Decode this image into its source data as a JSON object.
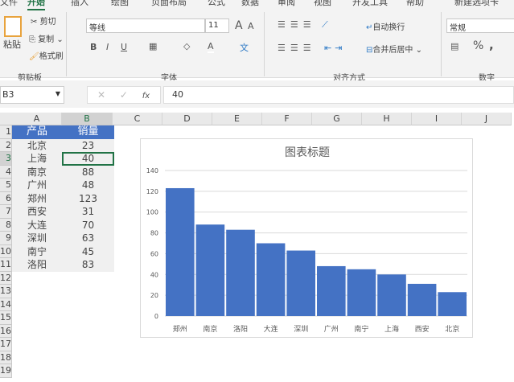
{
  "tabs": [
    "文件",
    "开始",
    "插入",
    "绘图",
    "页面布局",
    "公式",
    "数据",
    "审阅",
    "视图",
    "开发工具",
    "帮助",
    "新建选项卡"
  ],
  "clipboard": {
    "paste": "粘贴",
    "cut": "剪切",
    "copy": "复制",
    "format_painter": "格式刷",
    "group": "剪贴板"
  },
  "font": {
    "name": "等线",
    "size": "11",
    "bold": "B",
    "italic": "I",
    "underline": "U",
    "grow": "A",
    "shrink": "A",
    "color": "A",
    "group": "字体"
  },
  "alignment": {
    "wrap": "自动换行",
    "merge": "合并后居中",
    "group": "对齐方式"
  },
  "number": {
    "format": "常规",
    "percent": "%",
    "comma": ",",
    "group": "数字"
  },
  "formula_bar": {
    "name_box": "B3",
    "fx": "fx",
    "value": "40"
  },
  "columns": [
    "A",
    "B",
    "C",
    "D",
    "E",
    "F",
    "G",
    "H",
    "I",
    "J"
  ],
  "rows": [
    "1",
    "2",
    "3",
    "4",
    "5",
    "6",
    "7",
    "8",
    "9",
    "10",
    "11",
    "12",
    "13",
    "14",
    "15",
    "16",
    "17",
    "18",
    "19"
  ],
  "table": {
    "headers": [
      "产品",
      "销量"
    ],
    "rows": [
      [
        "北京",
        "23"
      ],
      [
        "上海",
        "40"
      ],
      [
        "南京",
        "88"
      ],
      [
        "广州",
        "48"
      ],
      [
        "郑州",
        "123"
      ],
      [
        "西安",
        "31"
      ],
      [
        "大连",
        "70"
      ],
      [
        "深圳",
        "63"
      ],
      [
        "南宁",
        "45"
      ],
      [
        "洛阳",
        "83"
      ]
    ]
  },
  "chart_data": {
    "type": "bar",
    "title": "图表标题",
    "categories": [
      "郑州",
      "南京",
      "洛阳",
      "大连",
      "深圳",
      "广州",
      "南宁",
      "上海",
      "西安",
      "北京"
    ],
    "values": [
      123,
      88,
      83,
      70,
      63,
      48,
      45,
      40,
      31,
      23
    ],
    "ylim": [
      0,
      140
    ],
    "yticks": [
      "0",
      "20",
      "40",
      "60",
      "80",
      "100",
      "120",
      "140"
    ],
    "grid": true,
    "color": "#4472c4"
  }
}
